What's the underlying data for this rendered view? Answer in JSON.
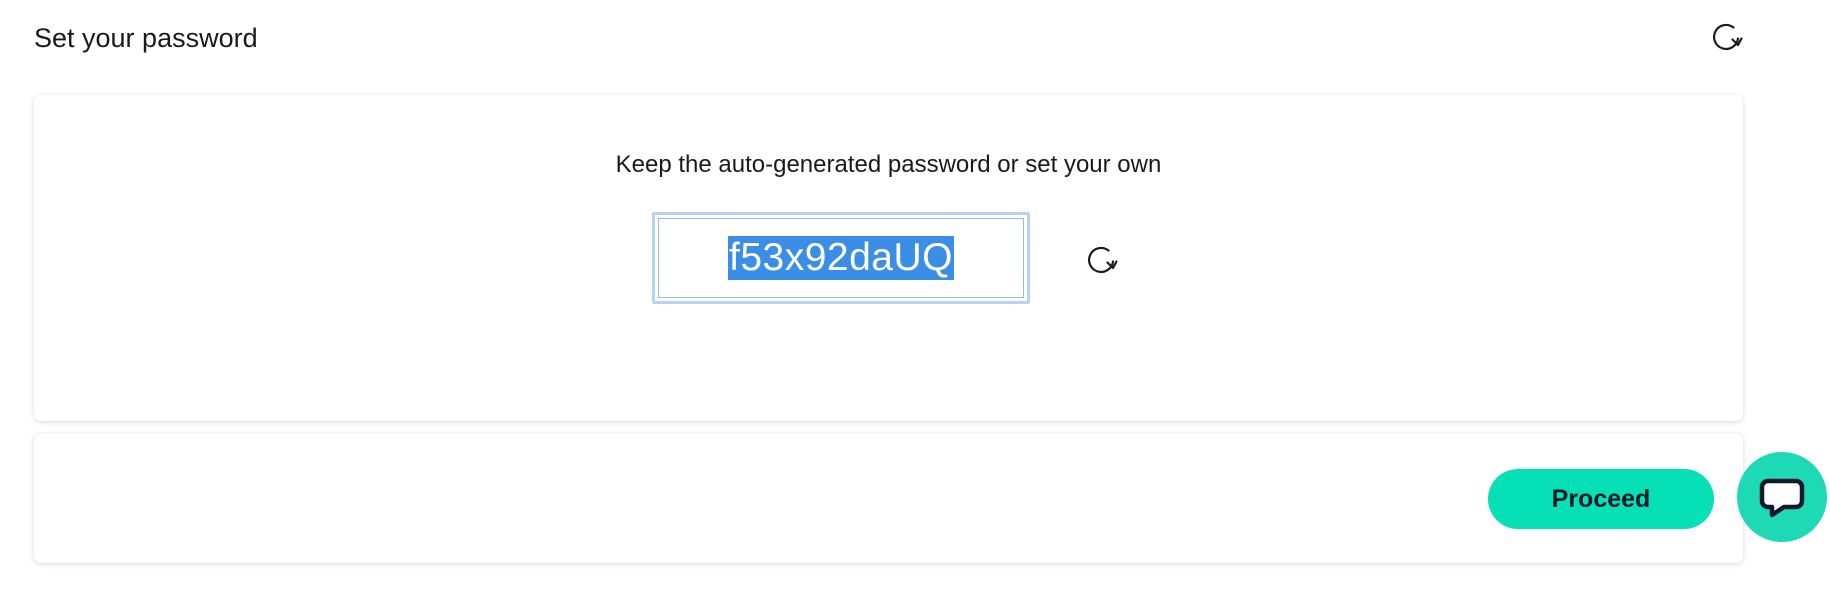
{
  "header": {
    "title": "Set your password",
    "refresh_icon": "refresh-icon"
  },
  "password_card": {
    "instruction": "Keep the auto-generated password or set your own",
    "password_value": "f53x92daUQ",
    "regenerate_icon": "refresh-icon"
  },
  "footer": {
    "proceed_label": "Proceed",
    "chat_icon": "chat-bubble-icon"
  },
  "colors": {
    "accent": "#06e0b6",
    "selection": "#3a8ee6",
    "field_focus_border": "#b7d3f4"
  }
}
